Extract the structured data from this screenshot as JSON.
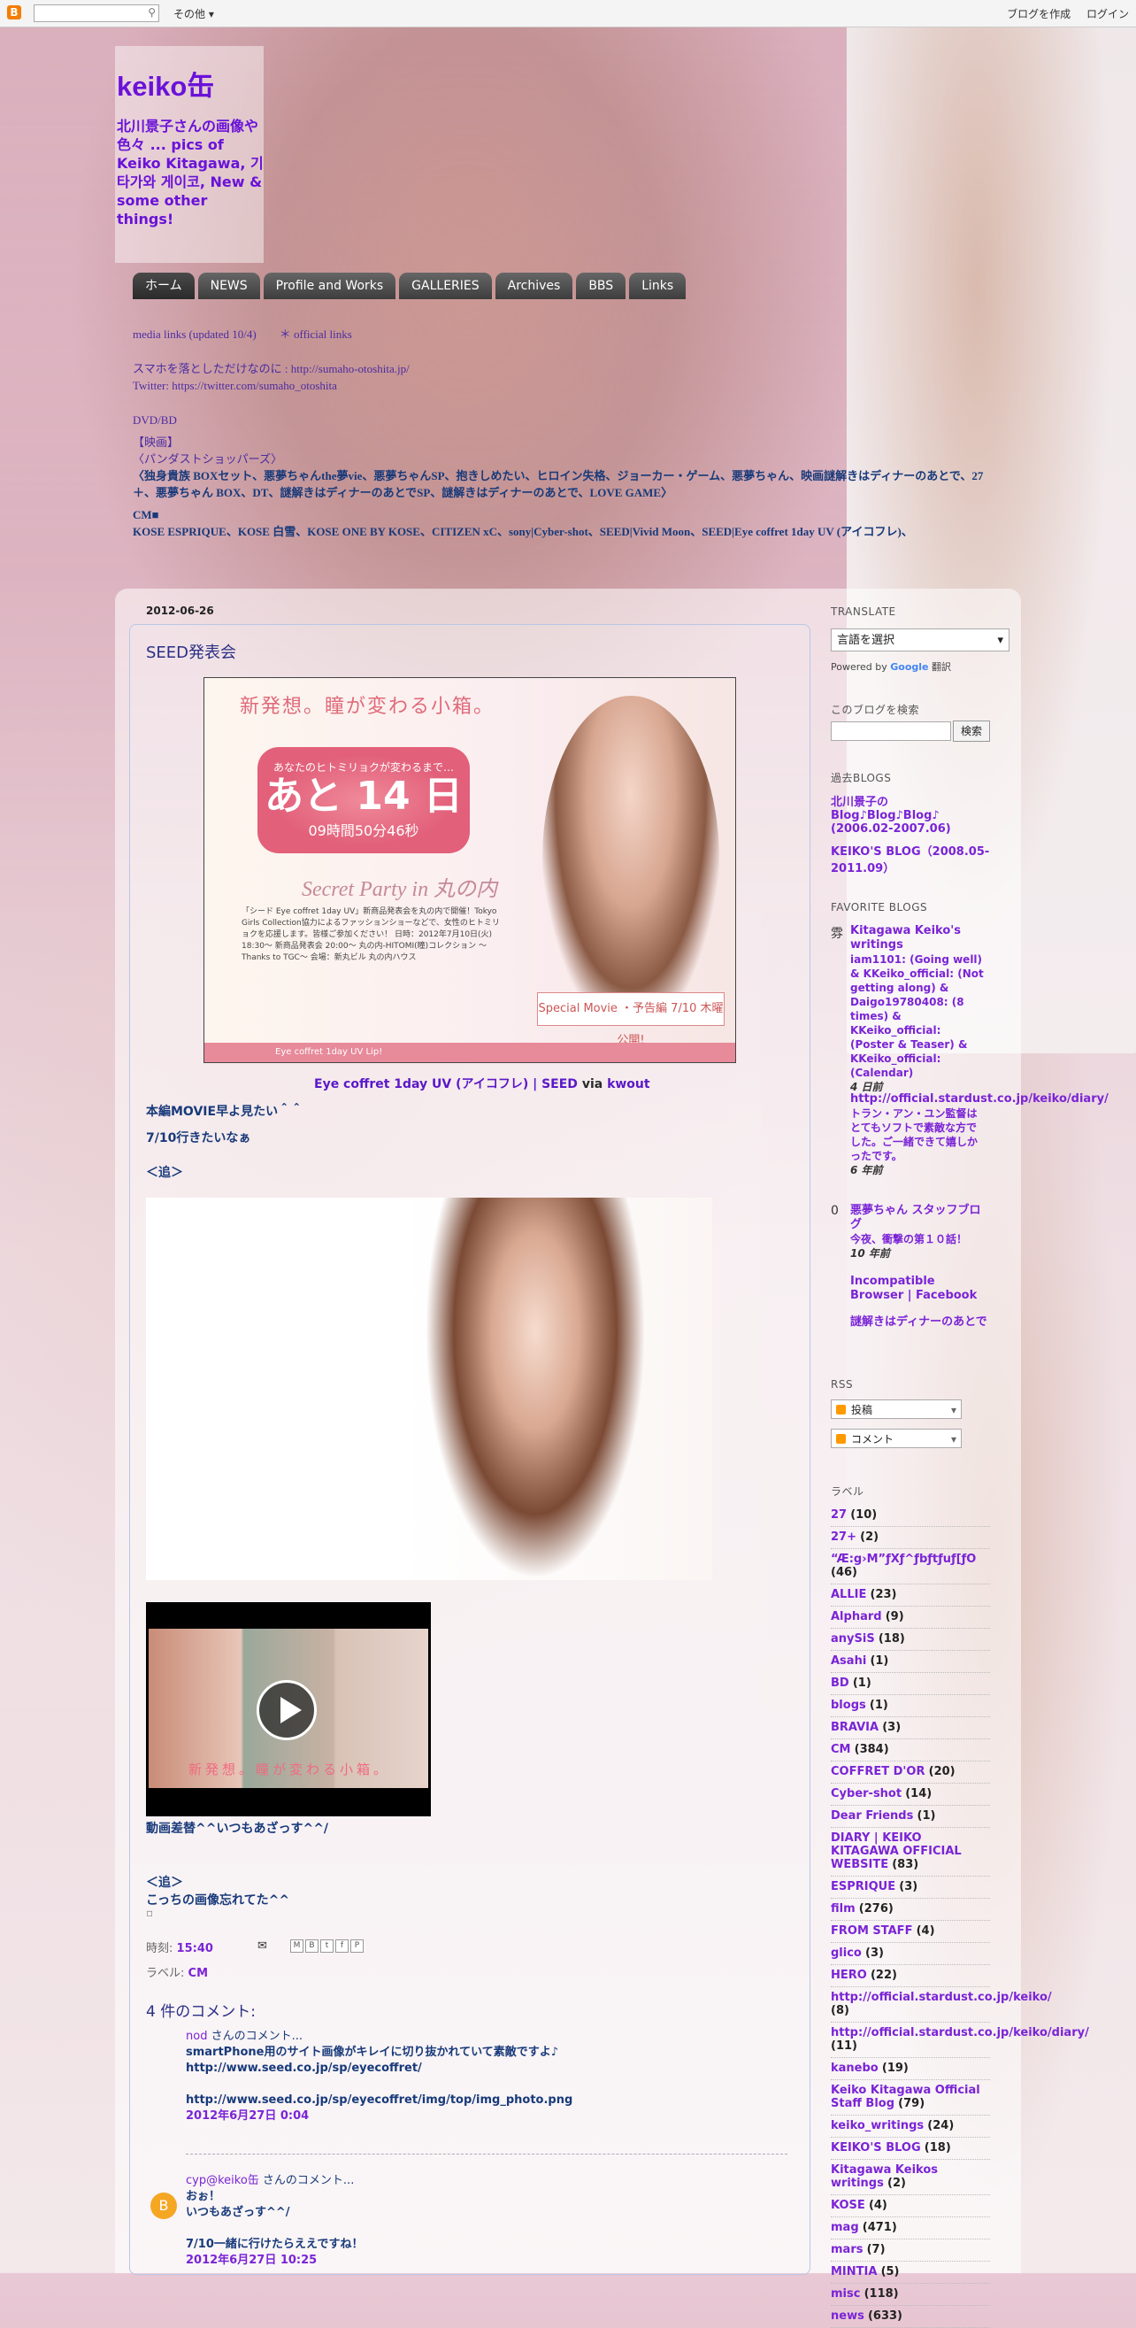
{
  "navbar": {
    "more": "その他 ▾",
    "create_blog": "ブログを作成",
    "login": "ログイン"
  },
  "header": {
    "title": "keiko缶",
    "description": "北川景子さんの画像や色々 ... pics of Keiko Kitagawa, 기타가와 게이코, New & some other things!",
    "tabs": [
      "ホーム",
      "NEWS",
      "Profile and Works",
      "GALLERIES",
      "Archives",
      "BBS",
      "Links"
    ],
    "lines": [
      "media links (updated 10/4)　　＊ official links",
      "スマホを落としただけなのに : http://sumaho-otoshita.jp/",
      "Twitter: https://twitter.com/sumaho_otoshita",
      "DVD/BD",
      "【映画】",
      "〈パンダストショッパーズ〉",
      "〈独身貴族 BOXセット、悪夢ちゃんthe夢vie、悪夢ちゃんSP、抱きしめたい、ヒロイン失格、ジョーカー・ゲーム、悪夢ちゃん、映画謎解きはディナーのあとで、27＋、悪夢ちゃん BOX、DT、謎解きはディナーのあとでSP、謎解きはディナーのあとで、LOVE GAME〉",
      "CM■",
      "KOSE ESPRIQUE、KOSE 白雪、KOSE ONE BY KOSE、CITIZEN xC、sony|Cyber-shot、SEED|Vivid Moon、SEED|Eye coffret 1day UV (アイコフレ)、"
    ]
  },
  "post": {
    "date": "2012-06-26",
    "title": "SEED発表会",
    "promo": {
      "headline": "新発想。瞳が変わる小箱。",
      "badge_sub": "あなたのヒトミリョクが変わるまで…",
      "badge_num": "あと 14 日",
      "badge_time": "09時間50分46秒",
      "secret": "Secret Party in 丸の内",
      "text": "「シード Eye coffret 1day UV」新商品発表会を丸の内で開催！Tokyo Girls Collection協力によるファッションショーなどで、女性のヒトミリョクを応援します。皆様ご参加ください！ 日時：2012年7月10日(火) 18:30〜 新商品発表会 20:00〜 丸の内-HITOMI(瞳)コレクション 〜Thanks to TGC〜 会場：新丸ビル 丸の内ハウス",
      "movie": "Special Movie ・予告編 7/10 木曜公開!",
      "footer": "Eye coffret 1day UV Lip!"
    },
    "caption_link": "Eye coffret 1day UV (アイコフレ) | SEED",
    "caption_via": "via",
    "caption_via_link": "kwout",
    "line1": "本編MOVIE早よ見たい＾＾",
    "line2": "7/10行きたいなぁ",
    "line3": "＜追＞",
    "video_text": "新発想。瞳が変わる小箱。",
    "line4": "動画差替^^いつもあざっす^^/",
    "line5": "＜追＞",
    "line6": "こっちの画像忘れてた^^",
    "time_label": "時刻:",
    "time": "15:40",
    "label_label": "ラベル:",
    "label": "CM",
    "comments_header": "4 件のコメント:"
  },
  "comments": [
    {
      "author": "nod",
      "author_suffix": " さんのコメント...",
      "lines": [
        "smartPhone用のサイト画像がキレイに切り抜かれていて素敵ですよ♪",
        "http://www.seed.co.jp/sp/eyecoffret/",
        "",
        "http://www.seed.co.jp/sp/eyecoffret/img/top/img_photo.png"
      ],
      "timestamp": "2012年6月27日 0:04"
    },
    {
      "author": "cyp@keiko缶",
      "author_suffix": " さんのコメント...",
      "lines": [
        "おぉ！",
        "いつもあざっす^^/",
        "",
        "7/10一緒に行けたらええですね！"
      ],
      "timestamp": "2012年6月27日 10:25"
    }
  ],
  "sidebar": {
    "translate_h": "TRANSLATE",
    "lang_select": "言語を選択",
    "powered": "Powered by",
    "google": "Google",
    "translate_word": "翻訳",
    "search_h": "このブログを検索",
    "search_btn": "検索",
    "past_h": "過去BLOGS",
    "past": [
      "北川景子の Blog♪Blog♪Blog♪ (2006.02-2007.06)",
      "KEIKO'S BLOG（2008.05-2011.09）"
    ],
    "fav_h": "FAVORITE BLOGS",
    "favs": [
      {
        "icon": "雰",
        "title": "Kitagawa Keiko's writings",
        "desc": "iam1101: (Going well) & KKeiko_official: (Not getting along) & Daigo19780408: (8 times) & KKeiko_official: (Poster & Teaser) & KKeiko_official: (Calendar)",
        "ago": "4 日前"
      },
      {
        "icon": "",
        "title": "http://official.stardust.co.jp/keiko/diary/",
        "desc": "トラン・アン・ユン監督はとてもソフトで素敵な方でした。ご一緒できて嬉しかったです。",
        "ago": "6 年前"
      },
      {
        "icon": "0",
        "title": "悪夢ちゃん スタッフブログ",
        "desc": "今夜、衝撃の第１０話！",
        "ago": "10 年前"
      },
      {
        "icon": "",
        "title": "Incompatible Browser | Facebook",
        "desc": "",
        "ago": ""
      },
      {
        "icon": "",
        "title": "謎解きはディナーのあとで",
        "desc": "",
        "ago": ""
      }
    ],
    "rss_h": "RSS",
    "rss": [
      "投稿",
      "コメント"
    ],
    "labels_h": "ラベル",
    "labels": [
      [
        "27",
        "(10)"
      ],
      [
        "27+",
        "(2)"
      ],
      [
        "“Æ:g›M”ƒXƒ^ƒbƒtƒuƒ[ƒO",
        "(46)"
      ],
      [
        "ALLIE",
        "(23)"
      ],
      [
        "Alphard",
        "(9)"
      ],
      [
        "anySiS",
        "(18)"
      ],
      [
        "Asahi",
        "(1)"
      ],
      [
        "BD",
        "(1)"
      ],
      [
        "blogs",
        "(1)"
      ],
      [
        "BRAVIA",
        "(3)"
      ],
      [
        "CM",
        "(384)"
      ],
      [
        "COFFRET D'OR",
        "(20)"
      ],
      [
        "Cyber-shot",
        "(14)"
      ],
      [
        "Dear Friends",
        "(1)"
      ],
      [
        "DIARY | KEIKO KITAGAWA OFFICIAL WEBSITE",
        "(83)"
      ],
      [
        "ESPRIQUE",
        "(3)"
      ],
      [
        "film",
        "(276)"
      ],
      [
        "FROM STAFF",
        "(4)"
      ],
      [
        "glico",
        "(3)"
      ],
      [
        "HERO",
        "(22)"
      ],
      [
        "http://official.stardust.co.jp/keiko/",
        "(8)"
      ],
      [
        "http://official.stardust.co.jp/keiko/diary/",
        "(11)"
      ],
      [
        "kanebo",
        "(19)"
      ],
      [
        "Keiko Kitagawa Official Staff Blog",
        "(79)"
      ],
      [
        "keiko_writings",
        "(24)"
      ],
      [
        "KEIKO'S BLOG",
        "(18)"
      ],
      [
        "Kitagawa Keikos writings",
        "(2)"
      ],
      [
        "KOSE",
        "(4)"
      ],
      [
        "mag",
        "(471)"
      ],
      [
        "mars",
        "(7)"
      ],
      [
        "MINTIA",
        "(5)"
      ],
      [
        "misc",
        "(118)"
      ],
      [
        "news",
        "(633)"
      ]
    ]
  }
}
